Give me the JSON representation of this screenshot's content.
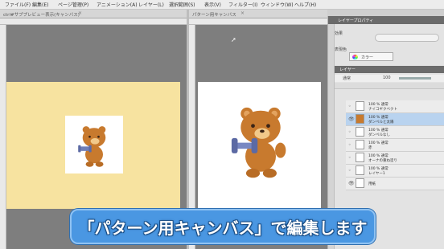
{
  "menubar": {
    "items": [
      "ファイル(F)",
      "編集(E)",
      "ページ管理(P)",
      "アニメーション(A)",
      "レイヤー(L)",
      "選択範囲(S)",
      "表示(V)",
      "フィルター(I)",
      "ウィンドウ(W)",
      "ヘルプ(H)"
    ]
  },
  "tabs": {
    "left": "ctrl#サブプレビュー表示(キャンバス)",
    "right": "パターン用キャンバス"
  },
  "panel": {
    "sub_tool_label": "レイヤープロパティ",
    "effect_label": "効果",
    "color_label": "表現色",
    "color_value": "カラー",
    "layer_tab": "レイヤー",
    "blend_mode": "通常",
    "opacity": "100",
    "layers": [
      {
        "line1": "100 % 通常",
        "line2": "ナイコギクベクト"
      },
      {
        "line1": "100 % 通常",
        "line2": "ダンベルと太陽"
      },
      {
        "line1": "100 % 通常",
        "line2": "ダンベルなし"
      },
      {
        "line1": "100 % 通常",
        "line2": "赤"
      },
      {
        "line1": "100 % 通常",
        "line2": "オーナの重ね塗り"
      },
      {
        "line1": "100 % 通常",
        "line2": "レイヤー1"
      },
      {
        "line1": "",
        "line2": "用紙"
      }
    ]
  },
  "caption": "「パターン用キャンバス」で編集します",
  "colors": {
    "caption_bg": "#4a97e2",
    "left_canvas_bg": "#f7e3a0",
    "selected_layer": "#b9d3ef"
  }
}
